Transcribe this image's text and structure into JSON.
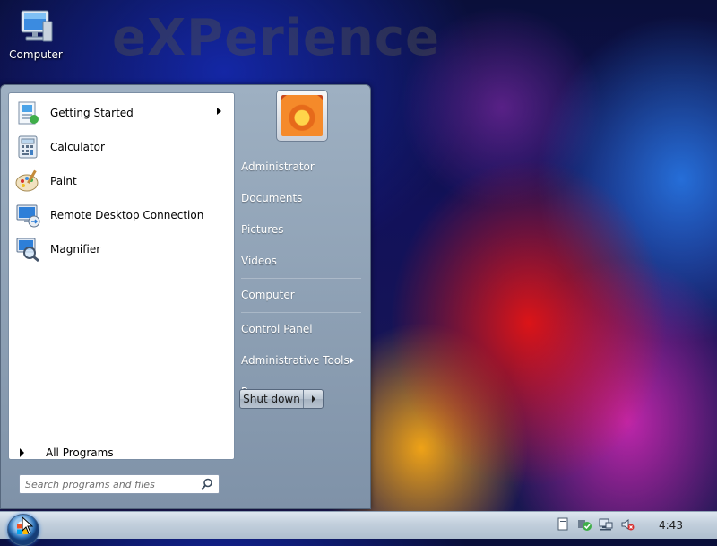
{
  "desktop": {
    "watermark": "eXPerience",
    "icons": [
      {
        "label": "Computer",
        "icon": "computer-icon"
      }
    ]
  },
  "start_menu": {
    "programs": [
      {
        "label": "Getting Started",
        "icon": "getting-started-icon",
        "has_submenu": true
      },
      {
        "label": "Calculator",
        "icon": "calculator-icon",
        "has_submenu": false
      },
      {
        "label": "Paint",
        "icon": "paint-icon",
        "has_submenu": false
      },
      {
        "label": "Remote Desktop Connection",
        "icon": "remote-desktop-icon",
        "has_submenu": false
      },
      {
        "label": "Magnifier",
        "icon": "magnifier-icon",
        "has_submenu": false
      }
    ],
    "all_programs_label": "All Programs",
    "search": {
      "placeholder": "Search programs and files",
      "value": ""
    },
    "right_items": [
      {
        "label": "Administrator"
      },
      {
        "label": "Documents"
      },
      {
        "label": "Pictures"
      },
      {
        "label": "Videos"
      },
      {
        "label": "Computer"
      },
      {
        "label": "Control Panel"
      },
      {
        "label": "Administrative Tools",
        "has_submenu": true
      },
      {
        "label": "Run..."
      }
    ],
    "shutdown_label": "Shut down"
  },
  "taskbar": {
    "clock": "4:43",
    "tray_icons": [
      "action-center-icon",
      "security-check-icon",
      "network-icon",
      "volume-muted-icon"
    ]
  },
  "colors": {
    "menu_frame": "#8fa2b8",
    "taskbar": "#c2cfdc",
    "right_pane_text": "#ffffff"
  }
}
